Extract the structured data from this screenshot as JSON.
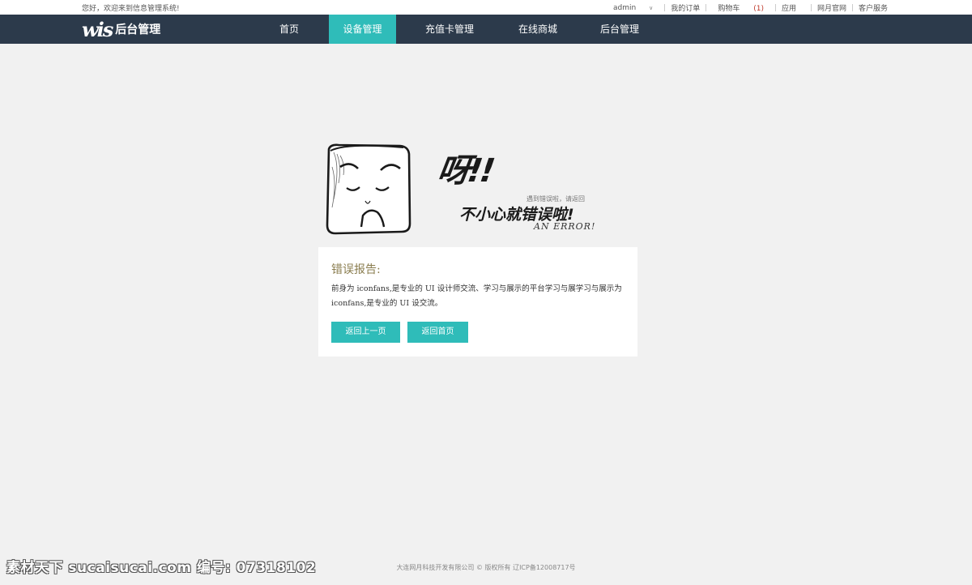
{
  "topbar": {
    "welcome": "您好，欢迎来到信息管理系统!",
    "user": "admin",
    "orders": "我的订单",
    "cart": "购物车",
    "cart_count": "(1)",
    "apps": "应用",
    "official_site": "网月官网",
    "service": "客户服务"
  },
  "navbar": {
    "logo_mark": "wis",
    "logo_text": "后台管理",
    "items": [
      {
        "label": "首页"
      },
      {
        "label": "设备管理"
      },
      {
        "label": "充值卡管理"
      },
      {
        "label": "在线商城"
      },
      {
        "label": "后台管理"
      }
    ],
    "active_index": 1
  },
  "error_art": {
    "exclaim": "呀!!",
    "hint": "遇到错误啦，请返回",
    "headline": "不小心就错误啦!",
    "english": "AN ERROR!"
  },
  "report": {
    "title": "错误报告:",
    "body": "前身为 iconfans,是专业的 UI 设计师交流、学习与展示的平台学习与展学习与展示为 iconfans,是专业的 UI 设交流。",
    "btn_back": "返回上一页",
    "btn_home": "返回首页"
  },
  "footer": {
    "text": "大连网月科技开发有限公司 © 版权所有 辽ICP备12008717号"
  },
  "watermark": {
    "text": "素材天下 sucaisucai.com  编号: 07318102"
  },
  "colors": {
    "nav_bg": "#2c3a4b",
    "accent": "#2fbcb9",
    "page_bg": "#f1f1f1"
  }
}
